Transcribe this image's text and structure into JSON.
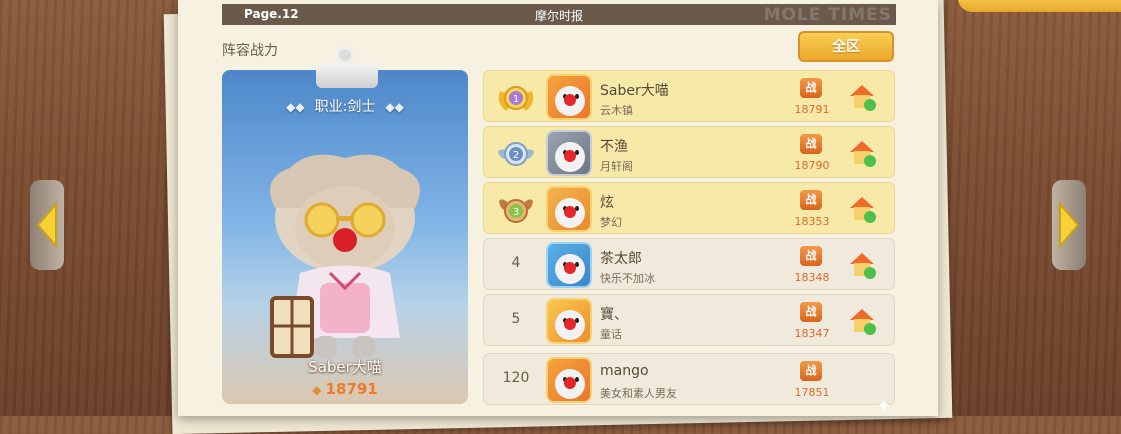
{
  "header": {
    "page": "Page.12",
    "title": "摩尔时报",
    "watermark": "MOLE TIMES"
  },
  "section_label": "阵容战力",
  "filter_button": "全区",
  "character": {
    "job": "职业:剑士",
    "name": "Saber大喵",
    "power": "18791"
  },
  "ranking": [
    {
      "rank": "1",
      "medal": "gold",
      "name": "Saber大喵",
      "server": "云木镇",
      "power": "18791",
      "power_icon": "战"
    },
    {
      "rank": "2",
      "medal": "silver",
      "name": "不渔",
      "server": "月轩阁",
      "power": "18790",
      "power_icon": "战"
    },
    {
      "rank": "3",
      "medal": "bronze",
      "name": "炫",
      "server": "梦幻",
      "power": "18353",
      "power_icon": "战"
    },
    {
      "rank": "4",
      "name": "茶太郎",
      "server": "快乐不加冰",
      "power": "18348",
      "power_icon": "战"
    },
    {
      "rank": "5",
      "name": "寶、",
      "server": "童话",
      "power": "18347",
      "power_icon": "战"
    }
  ],
  "my_rank": {
    "rank": "120",
    "name": "mango",
    "server": "美女和素人男友",
    "power": "17851",
    "power_icon": "战"
  },
  "colors": {
    "gold": "#f0b627",
    "silver": "#9db9d6",
    "bronze": "#d08a45",
    "power_text": "#e06a2a"
  },
  "icons": {
    "home": "home-go-icon",
    "prev": "arrow-left-icon",
    "next": "arrow-right-icon"
  }
}
